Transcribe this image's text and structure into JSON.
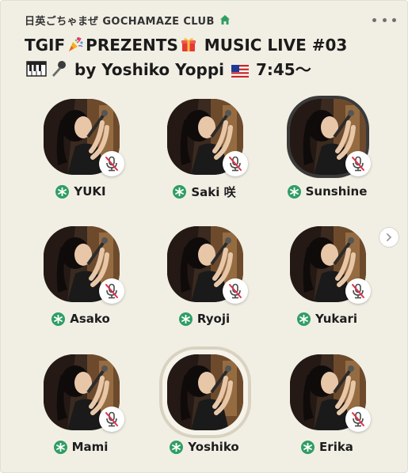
{
  "room": {
    "club_name": "日英ごちゃまぜ GOCHAMAZE CLUB",
    "title_parts": [
      "TGIF",
      "PREZENTS",
      " MUSIC LIVE #03",
      "by Yoshiko Yoppi",
      "7:45〜"
    ]
  },
  "icons": {
    "club": "house-icon",
    "more": "more-dots-icon",
    "party": "party-popper-icon",
    "gift": "gift-icon",
    "piano": "piano-keys-icon",
    "microphone": "microphone-icon",
    "flag": "us-flag-icon",
    "muted": "muted-mic-icon",
    "badge": "new-member-badge-icon",
    "next": "chevron-right-icon"
  },
  "colors": {
    "background": "#f1efe4",
    "badge_green": "#2f9e63",
    "muted_red": "#e0304a"
  },
  "speakers": [
    {
      "name": "YUKI",
      "muted": true
    },
    {
      "name": "Saki 咲",
      "muted": true
    },
    {
      "name": "Sunshine",
      "muted": true
    },
    {
      "name": "Asako",
      "muted": true
    },
    {
      "name": "Ryoji",
      "muted": true
    },
    {
      "name": "Yukari",
      "muted": true
    },
    {
      "name": "Mami",
      "muted": true
    },
    {
      "name": "Yoshiko",
      "muted": false
    },
    {
      "name": "Erika",
      "muted": true
    }
  ]
}
